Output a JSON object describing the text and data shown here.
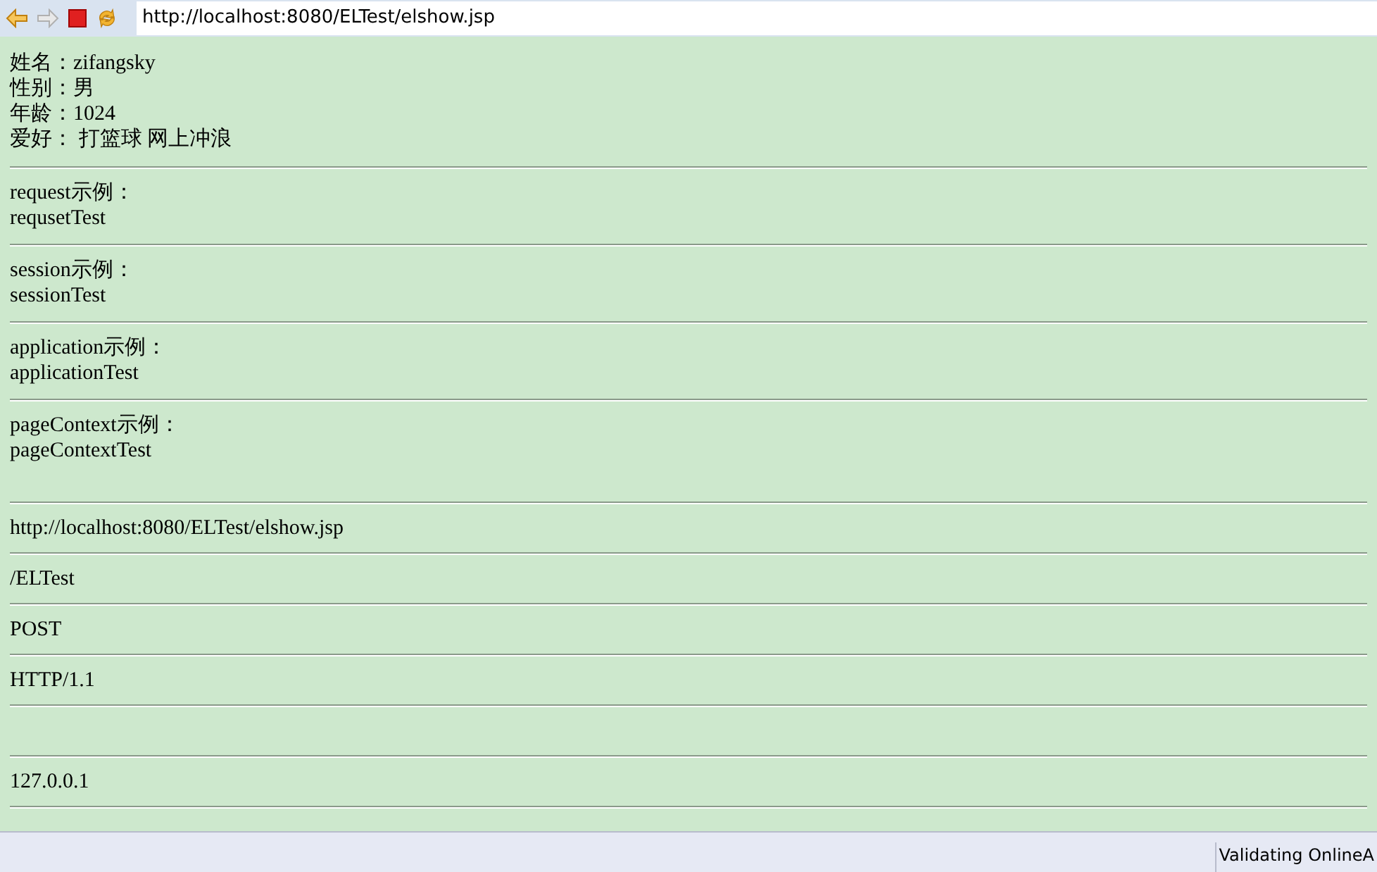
{
  "address_bar": {
    "url": "http://localhost:8080/ELTest/elshow.jsp"
  },
  "profile": [
    {
      "label": "姓名：",
      "value": "zifangsky"
    },
    {
      "label": "性别：",
      "value": "男"
    },
    {
      "label": "年龄：",
      "value": "1024"
    },
    {
      "label": "爱好：",
      "value": " 打篮球 网上冲浪"
    }
  ],
  "scopes": [
    {
      "label": "request示例：",
      "value": "requsetTest"
    },
    {
      "label": "session示例：",
      "value": "sessionTest"
    },
    {
      "label": "application示例：",
      "value": "applicationTest"
    },
    {
      "label": "pageContext示例：",
      "value": "pageContextTest"
    }
  ],
  "request_info": [
    {
      "kind": "text",
      "text": "http://localhost:8080/ELTest/elshow.jsp"
    },
    {
      "kind": "text",
      "text": "/ELTest"
    },
    {
      "kind": "text",
      "text": "POST"
    },
    {
      "kind": "text",
      "text": "HTTP/1.1"
    },
    {
      "kind": "blank"
    },
    {
      "kind": "text",
      "text": "127.0.0.1"
    }
  ],
  "status_bar": {
    "text": "Validating OnlineA"
  }
}
